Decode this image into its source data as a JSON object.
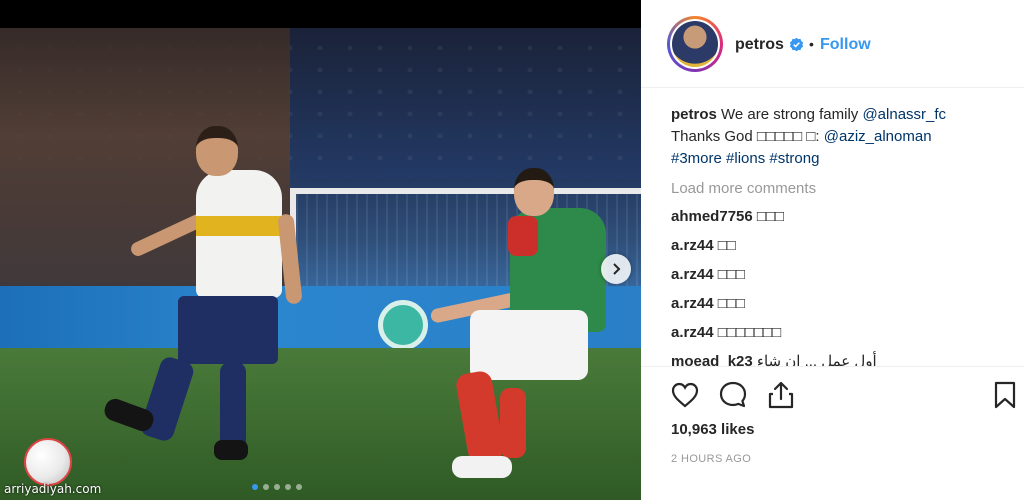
{
  "post": {
    "watermark": "arriyadiyah.com",
    "carousel": {
      "slides": 5,
      "active_index": 0
    }
  },
  "header": {
    "username": "petros",
    "separator": "•",
    "follow_label": "Follow"
  },
  "caption": {
    "user": "petros",
    "text1": " We are strong family ",
    "mention1": "@alnassr_fc",
    "text2": "Thanks God □□□□□ □: ",
    "mention2": "@aziz_alnoman",
    "tags": "#3more #lions #strong"
  },
  "load_more_label": "Load more comments",
  "comments": [
    {
      "user": "ahmed7756",
      "text": " □□□"
    },
    {
      "user": "a.rz44",
      "text": " □□"
    },
    {
      "user": "a.rz44",
      "text": " □□□"
    },
    {
      "user": "a.rz44",
      "text": " □□□"
    },
    {
      "user": "a.rz44",
      "text": " □□□□□□□"
    },
    {
      "user": "moead_k23",
      "text": "  أول عمل ... إن شاء"
    }
  ],
  "likes_label": "10,963 likes",
  "time_label": "2 HOURS AGO",
  "colors": {
    "accent": "#3897f0",
    "link": "#003569",
    "muted": "#999999"
  }
}
